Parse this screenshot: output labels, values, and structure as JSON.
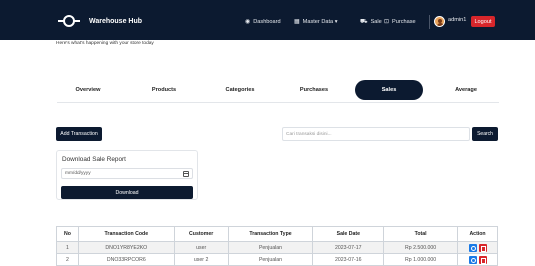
{
  "navbar": {
    "brand": "Warehouse Hub",
    "items": [
      {
        "label": "Dashboard",
        "icon": "dashboard-icon"
      },
      {
        "label": "Master Data ▾",
        "icon": "grid-icon"
      },
      {
        "label": "Sale",
        "icon": "cart-icon"
      },
      {
        "label": "Purchase",
        "icon": "bag-icon"
      }
    ],
    "username": "admin1",
    "logout": "Logout"
  },
  "greeting": "Here's what's happening with your store today",
  "tabs": [
    "Overview",
    "Products",
    "Categories",
    "Purchases",
    "Sales",
    "Average"
  ],
  "active_tab": "Sales",
  "toolbar": {
    "add_label": "Add Transaction",
    "search_placeholder": "Cari transaksi disini...",
    "search_label": "Search"
  },
  "download": {
    "title": "Download Sale Report",
    "date_placeholder": "mm/dd/yyyy",
    "button": "Download"
  },
  "table": {
    "headers": [
      "No",
      "Transaction Code",
      "Customer",
      "Transaction Type",
      "Sale Date",
      "Total",
      "Action"
    ],
    "rows": [
      [
        "1",
        "DNO1YR8YE2KO",
        "user",
        "Penjualan",
        "2023-07-17",
        "Rp 2.500.000"
      ],
      [
        "2",
        "DNO33RPCOR6",
        "user 2",
        "Penjualan",
        "2023-07-16",
        "Rp 1.000.000"
      ]
    ]
  },
  "colors": {
    "navy": "#0c1a30",
    "danger": "#d8262b",
    "primary": "#1a7ae6"
  }
}
